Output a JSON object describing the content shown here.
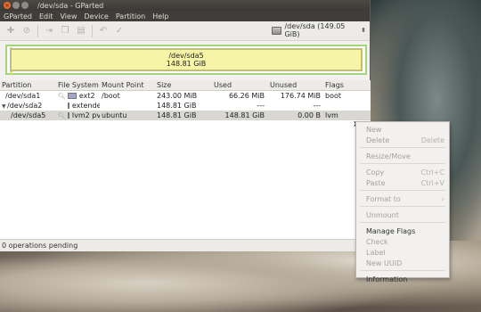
{
  "window": {
    "title": "/dev/sda - GParted"
  },
  "menubar": [
    "GParted",
    "Edit",
    "View",
    "Device",
    "Partition",
    "Help"
  ],
  "toolbar": {
    "icons": [
      "new-icon",
      "delete-icon",
      "resize-icon",
      "copy-icon",
      "paste-icon",
      "undo-icon",
      "apply-icon"
    ]
  },
  "device": {
    "label": "/dev/sda  (149.05 GiB)"
  },
  "partition_bar": {
    "name": "/dev/sda5",
    "size": "148.81 GiB"
  },
  "table": {
    "headers": [
      "Partition",
      "File System",
      "Mount Point",
      "Size",
      "Used",
      "Unused",
      "Flags"
    ],
    "rows": [
      {
        "partition": "/dev/sda1",
        "fs": "ext2",
        "fs_color": "#9fa6c9",
        "mount": "/boot",
        "size": "243.00 MiB",
        "used": "66.26 MiB",
        "unused": "176.74 MiB",
        "flags": "boot"
      },
      {
        "partition": "/dev/sda2",
        "fs": "extended",
        "fs_color": "#7ee7e7",
        "mount": "",
        "size": "148.81 GiB",
        "used": "---",
        "unused": "---",
        "flags": ""
      },
      {
        "partition": "/dev/sda5",
        "fs": "lvm2 pv",
        "fs_color": "#c4803c",
        "mount": "ubuntu",
        "size": "148.81 GiB",
        "used": "148.81 GiB",
        "unused": "0.00 B",
        "flags": "lvm"
      }
    ]
  },
  "status": {
    "text": "0 operations pending"
  },
  "context_menu": {
    "new": "New",
    "delete": "Delete",
    "delete_acc": "Delete",
    "resize": "Resize/Move",
    "copy": "Copy",
    "copy_acc": "Ctrl+C",
    "paste": "Paste",
    "paste_acc": "Ctrl+V",
    "format": "Format to",
    "format_acc": "›",
    "unmount": "Unmount",
    "manage_flags": "Manage Flags",
    "check": "Check",
    "label": "Label",
    "new_uuid": "New UUID",
    "information": "Information"
  }
}
